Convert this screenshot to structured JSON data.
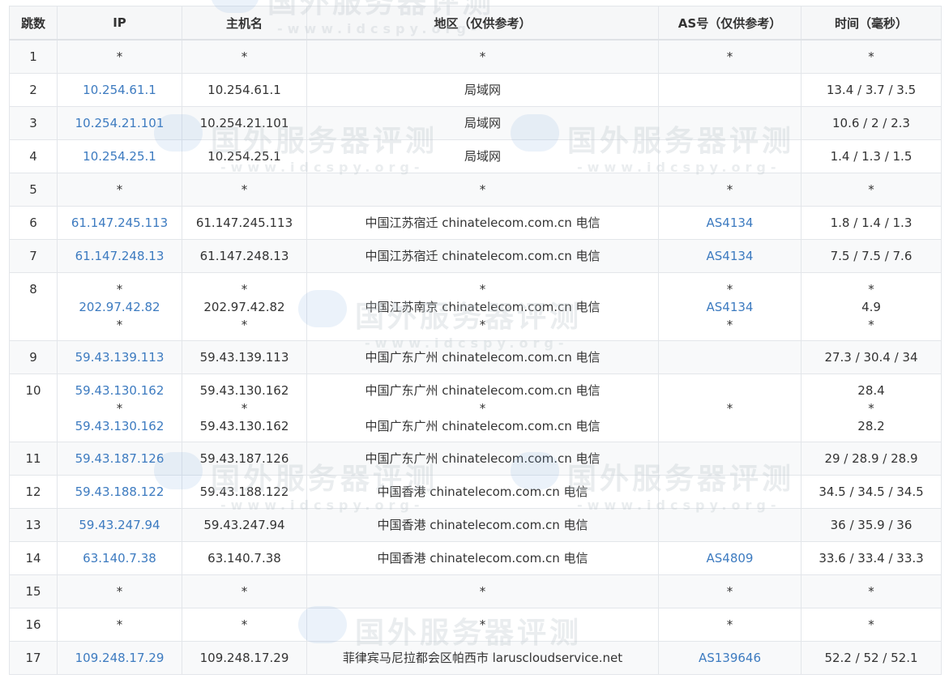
{
  "headers": {
    "hop": "跳数",
    "ip": "IP",
    "host": "主机名",
    "region": "地区（仅供参考）",
    "as": "AS号（仅供参考）",
    "time": "时间（毫秒）"
  },
  "watermark": {
    "title": "国外服务器评测",
    "subtitle": "-www.idcspy.org-"
  },
  "rows": [
    {
      "hop": "1",
      "ip": [
        "*"
      ],
      "host": [
        "*"
      ],
      "region": [
        "*"
      ],
      "as": [
        "*"
      ],
      "time": [
        "*"
      ]
    },
    {
      "hop": "2",
      "ip": [
        "10.254.61.1"
      ],
      "host": [
        "10.254.61.1"
      ],
      "region": [
        "局域网"
      ],
      "as": [
        ""
      ],
      "time": [
        "13.4 / 3.7 / 3.5"
      ]
    },
    {
      "hop": "3",
      "ip": [
        "10.254.21.101"
      ],
      "host": [
        "10.254.21.101"
      ],
      "region": [
        "局域网"
      ],
      "as": [
        ""
      ],
      "time": [
        "10.6 / 2 / 2.3"
      ]
    },
    {
      "hop": "4",
      "ip": [
        "10.254.25.1"
      ],
      "host": [
        "10.254.25.1"
      ],
      "region": [
        "局域网"
      ],
      "as": [
        ""
      ],
      "time": [
        "1.4 / 1.3 / 1.5"
      ]
    },
    {
      "hop": "5",
      "ip": [
        "*"
      ],
      "host": [
        "*"
      ],
      "region": [
        "*"
      ],
      "as": [
        "*"
      ],
      "time": [
        "*"
      ]
    },
    {
      "hop": "6",
      "ip": [
        "61.147.245.113"
      ],
      "host": [
        "61.147.245.113"
      ],
      "region": [
        "中国江苏宿迁 chinatelecom.com.cn 电信"
      ],
      "as": [
        "AS4134"
      ],
      "time": [
        "1.8 / 1.4 / 1.3"
      ]
    },
    {
      "hop": "7",
      "ip": [
        "61.147.248.13"
      ],
      "host": [
        "61.147.248.13"
      ],
      "region": [
        "中国江苏宿迁 chinatelecom.com.cn 电信"
      ],
      "as": [
        "AS4134"
      ],
      "time": [
        "7.5 / 7.5 / 7.6"
      ]
    },
    {
      "hop": "8",
      "ip": [
        "*",
        "202.97.42.82",
        "*"
      ],
      "host": [
        "*",
        "202.97.42.82",
        "*"
      ],
      "region": [
        "*",
        "中国江苏南京 chinatelecom.com.cn 电信",
        "*"
      ],
      "as": [
        "*",
        "AS4134",
        "*"
      ],
      "time": [
        "*",
        "4.9",
        "*"
      ]
    },
    {
      "hop": "9",
      "ip": [
        "59.43.139.113"
      ],
      "host": [
        "59.43.139.113"
      ],
      "region": [
        "中国广东广州 chinatelecom.com.cn 电信"
      ],
      "as": [
        ""
      ],
      "time": [
        "27.3 / 30.4 / 34"
      ]
    },
    {
      "hop": "10",
      "ip": [
        "59.43.130.162",
        "*",
        "59.43.130.162"
      ],
      "host": [
        "59.43.130.162",
        "*",
        "59.43.130.162"
      ],
      "region": [
        "中国广东广州 chinatelecom.com.cn 电信",
        "*",
        "中国广东广州 chinatelecom.com.cn 电信"
      ],
      "as": [
        "*"
      ],
      "time": [
        "28.4",
        "*",
        "28.2"
      ]
    },
    {
      "hop": "11",
      "ip": [
        "59.43.187.126"
      ],
      "host": [
        "59.43.187.126"
      ],
      "region": [
        "中国广东广州 chinatelecom.com.cn 电信"
      ],
      "as": [
        ""
      ],
      "time": [
        "29 / 28.9 / 28.9"
      ]
    },
    {
      "hop": "12",
      "ip": [
        "59.43.188.122"
      ],
      "host": [
        "59.43.188.122"
      ],
      "region": [
        "中国香港 chinatelecom.com.cn 电信"
      ],
      "as": [
        ""
      ],
      "time": [
        "34.5 / 34.5 / 34.5"
      ]
    },
    {
      "hop": "13",
      "ip": [
        "59.43.247.94"
      ],
      "host": [
        "59.43.247.94"
      ],
      "region": [
        "中国香港 chinatelecom.com.cn 电信"
      ],
      "as": [
        ""
      ],
      "time": [
        "36 / 35.9 / 36"
      ]
    },
    {
      "hop": "14",
      "ip": [
        "63.140.7.38"
      ],
      "host": [
        "63.140.7.38"
      ],
      "region": [
        "中国香港 chinatelecom.com.cn 电信"
      ],
      "as": [
        "AS4809"
      ],
      "time": [
        "33.6 / 33.4 / 33.3"
      ]
    },
    {
      "hop": "15",
      "ip": [
        "*"
      ],
      "host": [
        "*"
      ],
      "region": [
        "*"
      ],
      "as": [
        "*"
      ],
      "time": [
        "*"
      ]
    },
    {
      "hop": "16",
      "ip": [
        "*"
      ],
      "host": [
        "*"
      ],
      "region": [
        "*"
      ],
      "as": [
        "*"
      ],
      "time": [
        "*"
      ]
    },
    {
      "hop": "17",
      "ip": [
        "109.248.17.29"
      ],
      "host": [
        "109.248.17.29"
      ],
      "region": [
        "菲律宾马尼拉都会区帕西市 laruscloudservice.net"
      ],
      "as": [
        "AS139646"
      ],
      "time": [
        "52.2 / 52 / 52.1"
      ]
    }
  ],
  "colors": {
    "link": "#3d7bc0",
    "header_bg": "#f6f7f8",
    "stripe_bg": "#f8f9fa",
    "border": "#e3e6ea"
  }
}
